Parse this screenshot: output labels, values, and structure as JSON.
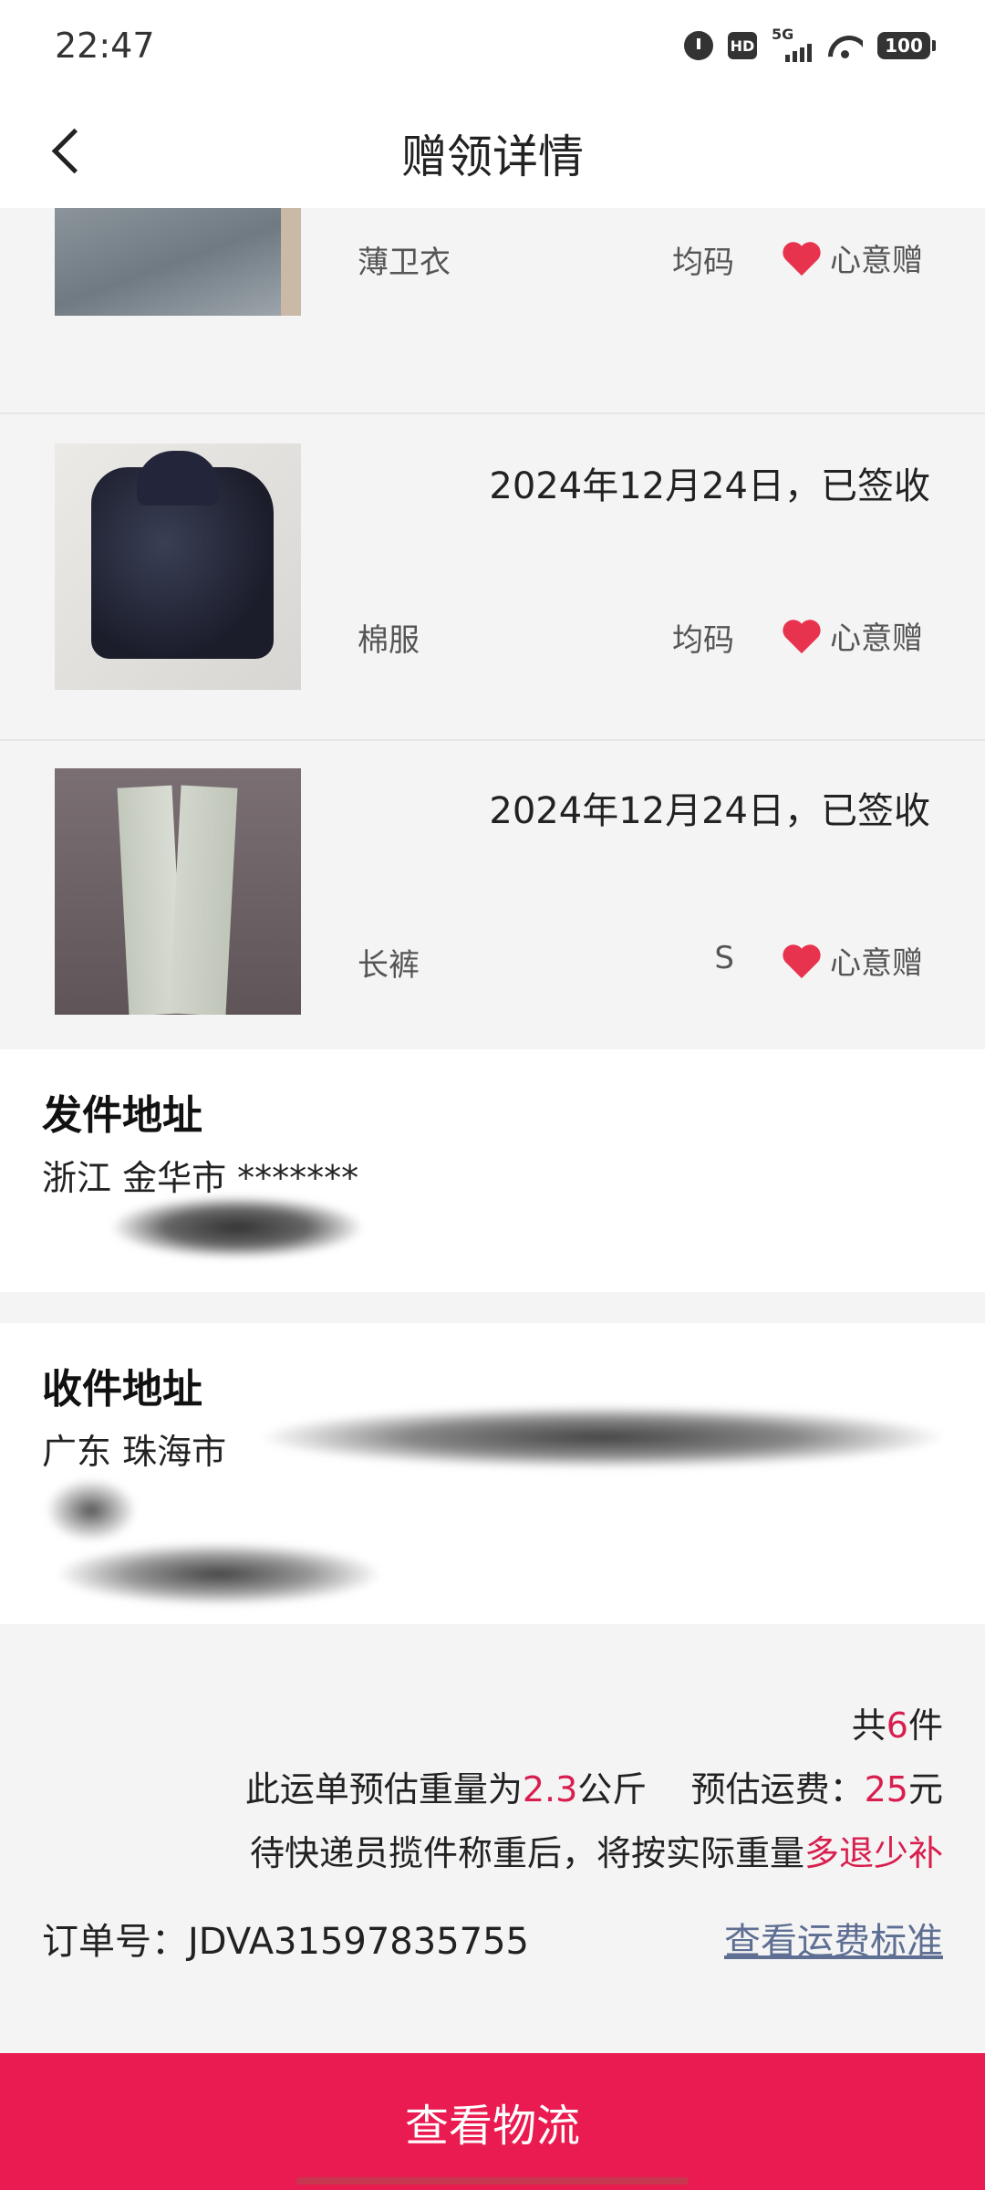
{
  "status_bar": {
    "time": "22:47",
    "hd": "HD",
    "network": "5G",
    "battery": "100"
  },
  "header": {
    "title": "赠领详情"
  },
  "items": [
    {
      "name": "薄卫衣",
      "size": "均码",
      "tag": "心意赠",
      "date": ""
    },
    {
      "name": "棉服",
      "size": "均码",
      "tag": "心意赠",
      "date": "2024年12月24日，已签收"
    },
    {
      "name": "长裤",
      "size": "S",
      "tag": "心意赠",
      "date": "2024年12月24日，已签收"
    }
  ],
  "sender": {
    "title": "发件地址",
    "line1": "浙江  金华市 *******"
  },
  "receiver": {
    "title": "收件地址",
    "line1": "广东  珠海市"
  },
  "summary": {
    "count_prefix": "共",
    "count": "6",
    "count_suffix": "件",
    "weight_prefix": "此运单预估重量为",
    "weight": "2.3",
    "weight_unit": "公斤",
    "fee_prefix": "预估运费：",
    "fee": "25",
    "fee_unit": "元",
    "notice_prefix": "待快递员揽件称重后，将按实际重量",
    "notice_highlight": "多退少补",
    "order_no": "订单号：JDVA31597835755",
    "fee_link": "查看运费标准"
  },
  "bottom_button": {
    "label": "查看物流"
  },
  "colors": {
    "accent": "#ea1b50",
    "highlight": "#d81e4e",
    "link": "#5e6f93",
    "heart": "#e8334f"
  }
}
